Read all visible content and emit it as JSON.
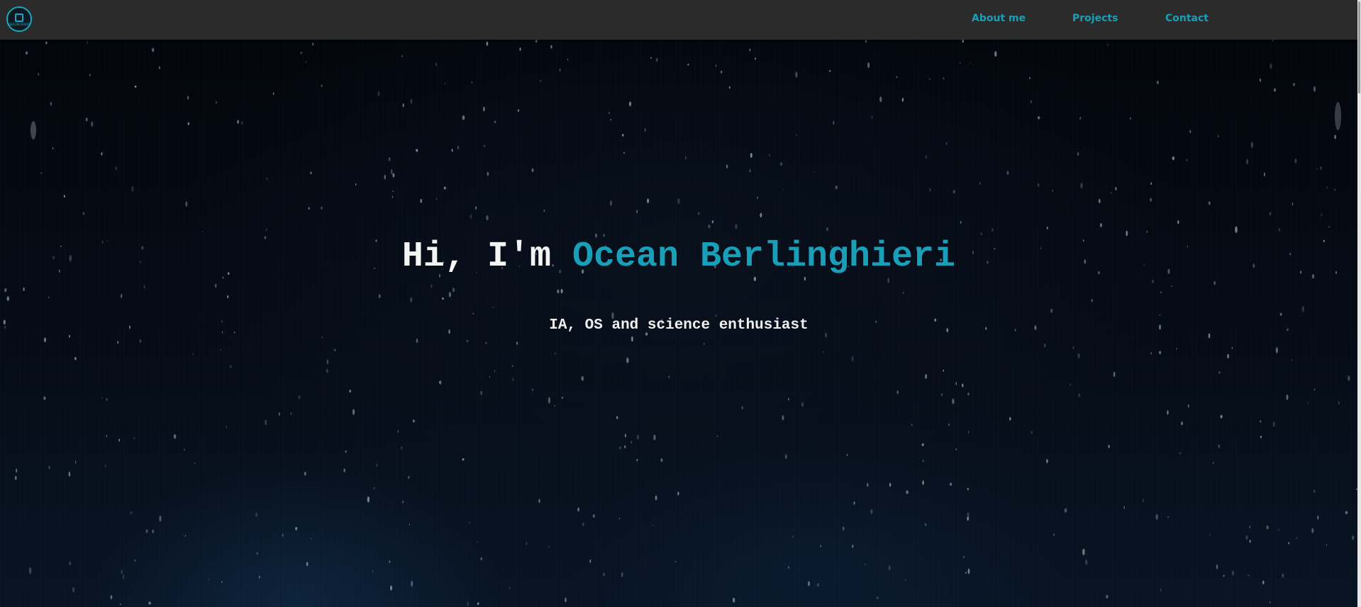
{
  "header": {
    "logo_text": "BERLINGHIERI",
    "nav": [
      {
        "label": "About me"
      },
      {
        "label": "Projects"
      },
      {
        "label": "Contact"
      }
    ]
  },
  "hero": {
    "greeting": "Hi, I'm ",
    "name": "Ocean Berlinghieri",
    "tagline": "IA, OS and science enthusiast"
  },
  "colors": {
    "accent": "#1a9fb8",
    "navbar_bg": "#2b2b2b",
    "hero_bg": "#050a12",
    "text": "#f4f4f4"
  },
  "icons": {
    "logo": "chip-logo-icon"
  }
}
